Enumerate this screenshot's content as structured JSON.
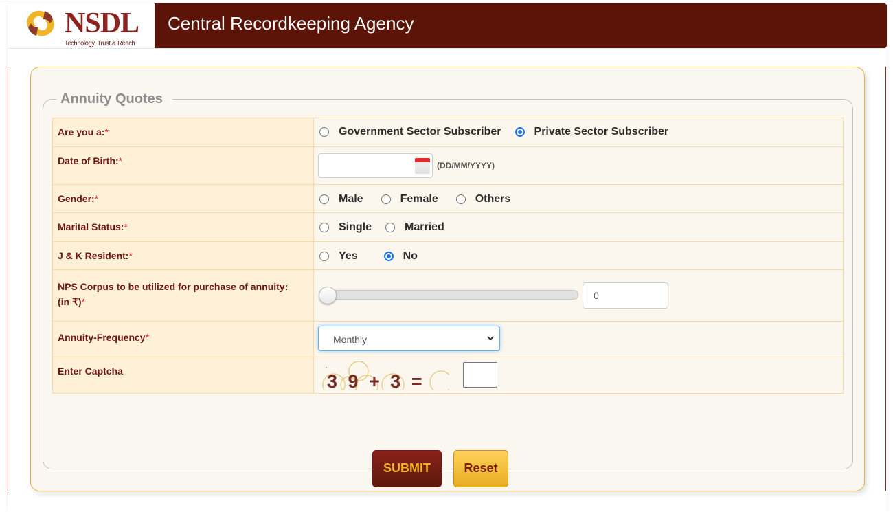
{
  "header": {
    "logo_name": "NSDL",
    "logo_tagline": "Technology, Trust & Reach",
    "title": "Central Recordkeeping Agency",
    "logo_icon": "nsdl-swirl-logo"
  },
  "form": {
    "legend": "Annuity Quotes",
    "required_marker": "*",
    "subscriber_type": {
      "label": "Are you a:",
      "options": [
        {
          "label": "Government Sector Subscriber",
          "checked": false
        },
        {
          "label": "Private Sector Subscriber",
          "checked": true
        }
      ]
    },
    "dob": {
      "label": "Date of Birth:",
      "value": "",
      "hint": "(DD/MM/YYYY)",
      "icon": "calendar-icon"
    },
    "gender": {
      "label": "Gender:",
      "options": [
        {
          "label": "Male",
          "checked": false
        },
        {
          "label": "Female",
          "checked": false
        },
        {
          "label": "Others",
          "checked": false
        }
      ]
    },
    "marital_status": {
      "label": "Marital Status:",
      "options": [
        {
          "label": "Single",
          "checked": false
        },
        {
          "label": "Married",
          "checked": false
        }
      ]
    },
    "jk_resident": {
      "label": "J & K Resident:",
      "options": [
        {
          "label": "Yes",
          "checked": false
        },
        {
          "label": "No",
          "checked": true
        }
      ]
    },
    "corpus": {
      "label_line1": "NPS Corpus to be utilized for purchase of annuity:",
      "label_line2": "(in ₹)",
      "slider_fraction": 0,
      "value": "0"
    },
    "frequency": {
      "label": "Annuity-Frequency",
      "selected": "Monthly"
    },
    "captcha": {
      "label": "Enter Captcha",
      "expression": "3 9 + 3 =",
      "value": ""
    },
    "buttons": {
      "submit": "SUBMIT",
      "reset": "Reset"
    }
  }
}
